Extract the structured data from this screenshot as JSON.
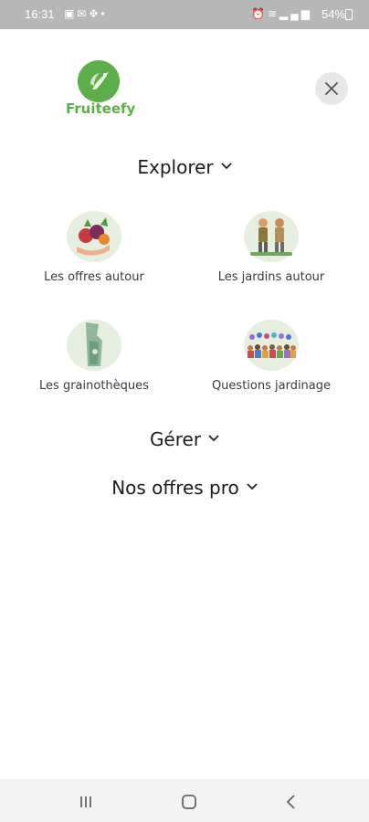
{
  "status_bar": {
    "time": "16:31",
    "left_icons": [
      "calendar-icon",
      "gmail-icon",
      "grid-icon",
      "dot-icon"
    ],
    "right_icons": [
      "alarm-icon",
      "wifi-icon",
      "signal-icon"
    ],
    "battery": "54%"
  },
  "header": {
    "logo_text": "Fruiteefy",
    "close_icon": "close-icon"
  },
  "sections": {
    "explorer": {
      "label": "Explorer",
      "items": [
        {
          "label": "Les offres autour",
          "icon": "fruits-hand-illustration"
        },
        {
          "label": "Les jardins autour",
          "icon": "gardeners-illustration"
        },
        {
          "label": "Les grainothèques",
          "icon": "seed-bag-illustration"
        },
        {
          "label": "Questions jardinage",
          "icon": "community-chat-illustration"
        }
      ]
    },
    "gerer": {
      "label": "Gérer"
    },
    "pro": {
      "label": "Nos offres pro"
    }
  },
  "nav_bar": {
    "items": [
      "recent-apps-icon",
      "home-icon",
      "back-icon"
    ]
  },
  "colors": {
    "brand_green": "#5cae4b",
    "blob_green": "#e6efdf",
    "status_bar": "#b7b7b7",
    "close_bg": "#e7e7e7"
  }
}
